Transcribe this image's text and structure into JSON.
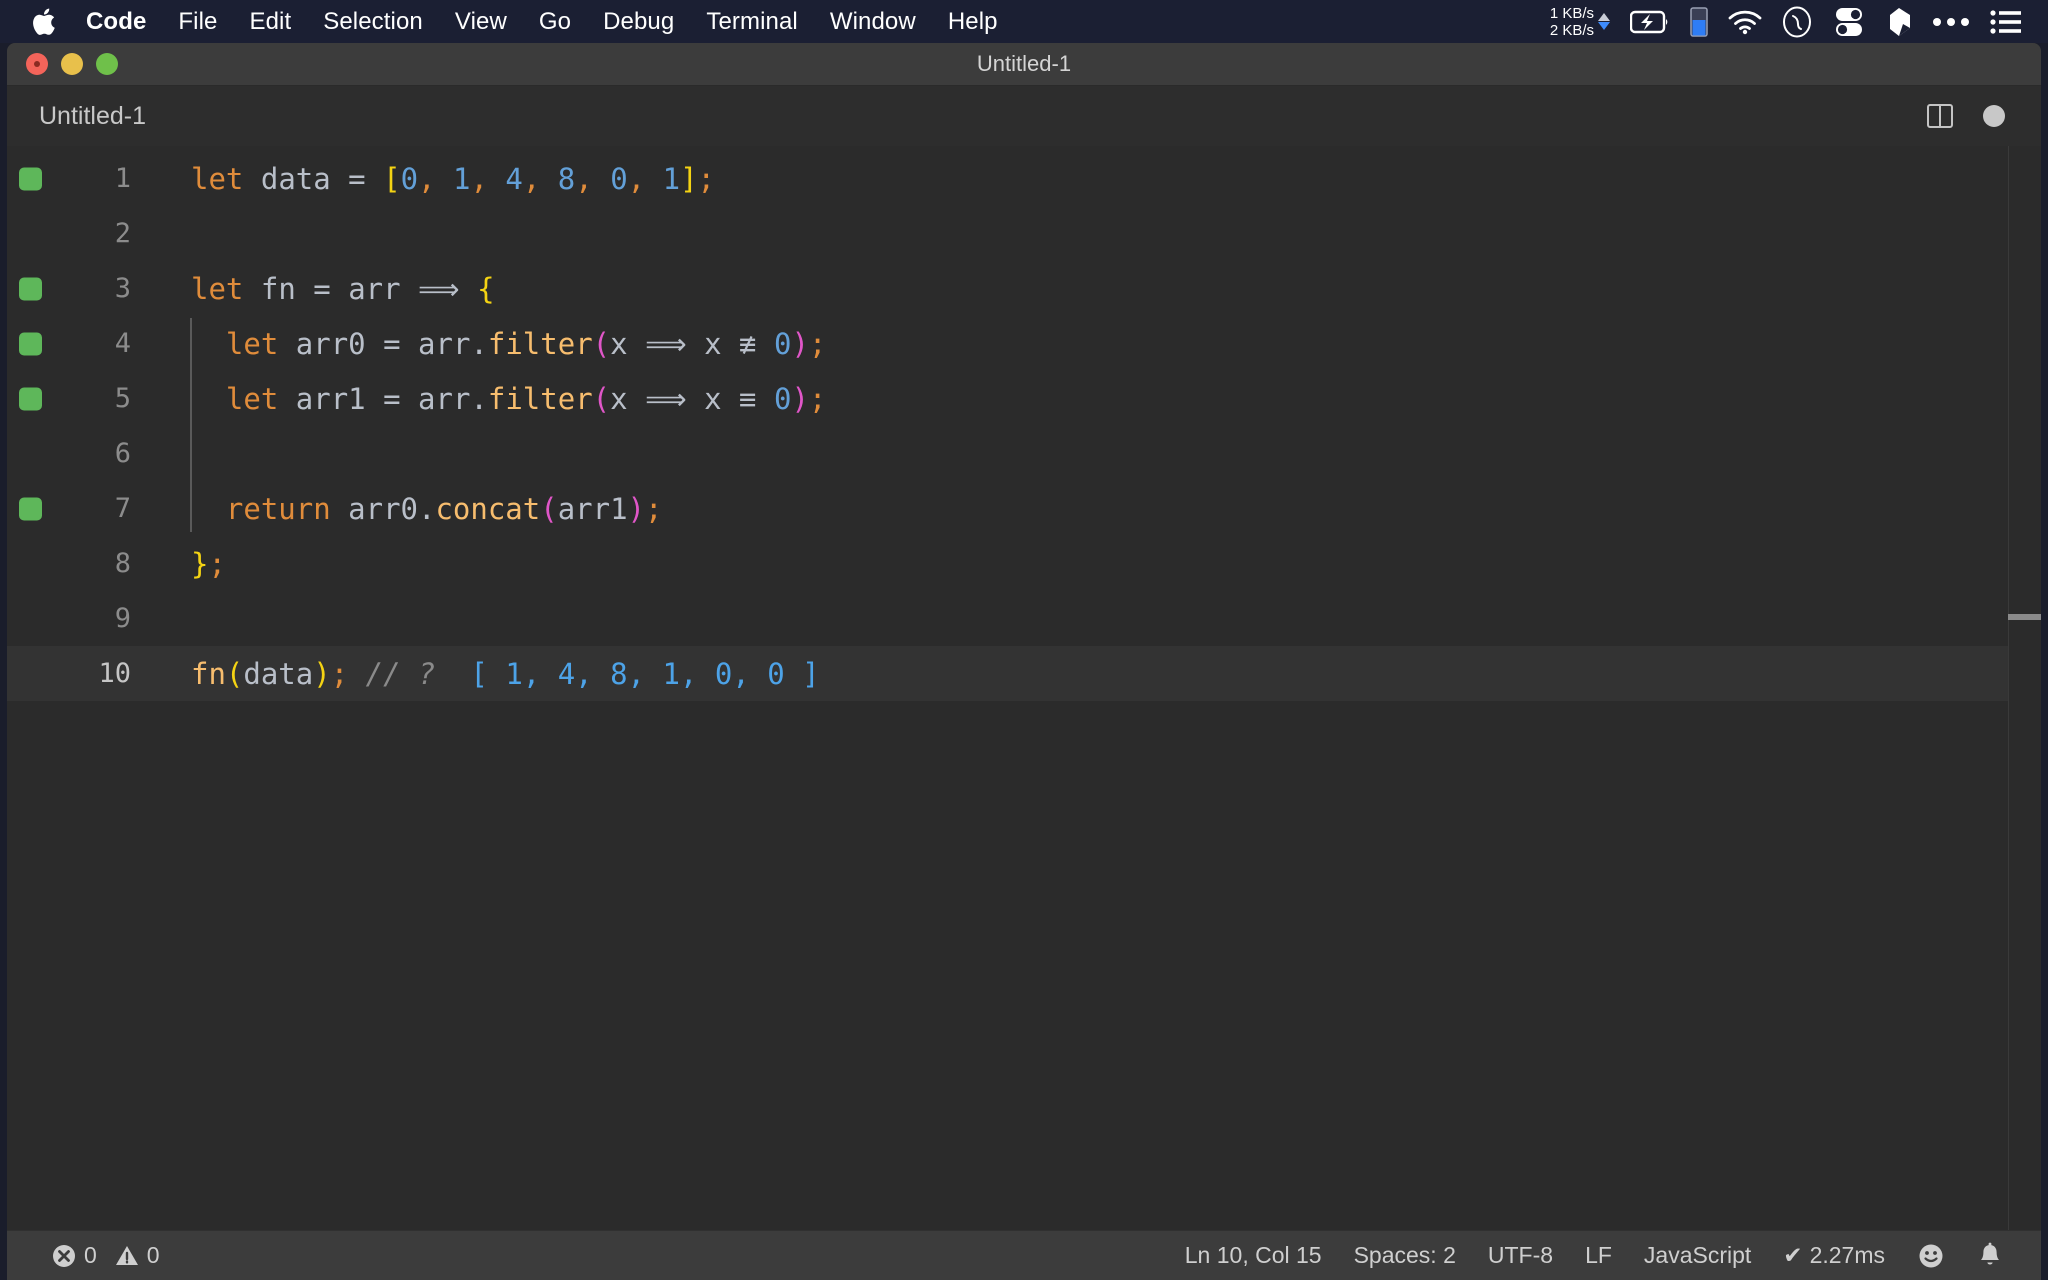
{
  "menubar": {
    "apple_icon": "apple-logo-icon",
    "items": [
      {
        "label": "Code",
        "bold": true
      },
      {
        "label": "File",
        "bold": false
      },
      {
        "label": "Edit",
        "bold": false
      },
      {
        "label": "Selection",
        "bold": false
      },
      {
        "label": "View",
        "bold": false
      },
      {
        "label": "Go",
        "bold": false
      },
      {
        "label": "Debug",
        "bold": false
      },
      {
        "label": "Terminal",
        "bold": false
      },
      {
        "label": "Window",
        "bold": false
      },
      {
        "label": "Help",
        "bold": false
      }
    ],
    "tray": {
      "upload_speed": "1 KB/s",
      "download_speed": "2 KB/s",
      "icons": [
        "battery-charging-icon",
        "battery-level-icon",
        "wifi-icon",
        "siri-icon",
        "control-center-icon",
        "dropbox-icon",
        "ellipsis-icon",
        "list-menu-icon"
      ]
    },
    "colors": {
      "background": "#1b1f33",
      "text": "#ffffff",
      "download_arrow": "#3d8bfd",
      "upload_arrow": "#c9ccd6"
    }
  },
  "window": {
    "title": "Untitled-1",
    "traffic_lights": [
      "close-button",
      "minimize-button",
      "maximize-button"
    ],
    "colors": {
      "titlebar": "#3c3c3c",
      "close": "#f4645a",
      "minimize": "#e8c04b",
      "maximize": "#6fc04a"
    }
  },
  "tabbar": {
    "tabs": [
      {
        "label": "Untitled-1",
        "active": true,
        "dirty": true
      }
    ],
    "actions": [
      "split-editor-icon",
      "unsaved-dot-icon"
    ]
  },
  "editor": {
    "language": "JavaScript",
    "colors": {
      "background": "#2b2b2b",
      "current_line": "#333333",
      "gutter_added": "#5eb75a",
      "keyword": "#e08c3b",
      "number": "#63a0d8",
      "bracket": "#f4d313",
      "paren": "#e056c8",
      "function": "#f7bd6e",
      "comment": "#8a8a8a",
      "result": "#4da3e8",
      "variable": "#b9bfc9"
    },
    "lines": [
      {
        "num": "1",
        "gutter": "added",
        "active": false,
        "indent": 0,
        "tokens": [
          {
            "t": "let",
            "c": "t-kw"
          },
          {
            "t": " ",
            "c": "t-var"
          },
          {
            "t": "data",
            "c": "t-var"
          },
          {
            "t": " ",
            "c": "t-var"
          },
          {
            "t": "=",
            "c": "t-op"
          },
          {
            "t": " ",
            "c": "t-var"
          },
          {
            "t": "[",
            "c": "t-brk"
          },
          {
            "t": "0",
            "c": "t-num"
          },
          {
            "t": ",",
            "c": "t-punc"
          },
          {
            "t": " ",
            "c": "t-var"
          },
          {
            "t": "1",
            "c": "t-num"
          },
          {
            "t": ",",
            "c": "t-punc"
          },
          {
            "t": " ",
            "c": "t-var"
          },
          {
            "t": "4",
            "c": "t-num"
          },
          {
            "t": ",",
            "c": "t-punc"
          },
          {
            "t": " ",
            "c": "t-var"
          },
          {
            "t": "8",
            "c": "t-num"
          },
          {
            "t": ",",
            "c": "t-punc"
          },
          {
            "t": " ",
            "c": "t-var"
          },
          {
            "t": "0",
            "c": "t-num"
          },
          {
            "t": ",",
            "c": "t-punc"
          },
          {
            "t": " ",
            "c": "t-var"
          },
          {
            "t": "1",
            "c": "t-num"
          },
          {
            "t": "]",
            "c": "t-brk"
          },
          {
            "t": ";",
            "c": "t-punc"
          }
        ]
      },
      {
        "num": "2",
        "gutter": "none",
        "active": false,
        "indent": 0,
        "tokens": []
      },
      {
        "num": "3",
        "gutter": "added",
        "active": false,
        "indent": 0,
        "tokens": [
          {
            "t": "let",
            "c": "t-kw"
          },
          {
            "t": " ",
            "c": "t-var"
          },
          {
            "t": "fn",
            "c": "t-var"
          },
          {
            "t": " ",
            "c": "t-var"
          },
          {
            "t": "=",
            "c": "t-op"
          },
          {
            "t": " ",
            "c": "t-var"
          },
          {
            "t": "arr",
            "c": "t-var"
          },
          {
            "t": " ",
            "c": "t-var"
          },
          {
            "t": "⟹",
            "c": "t-op"
          },
          {
            "t": " ",
            "c": "t-var"
          },
          {
            "t": "{",
            "c": "t-brk"
          }
        ]
      },
      {
        "num": "4",
        "gutter": "added",
        "active": false,
        "indent": 1,
        "tokens": [
          {
            "t": "  ",
            "c": "t-var"
          },
          {
            "t": "let",
            "c": "t-kw"
          },
          {
            "t": " ",
            "c": "t-var"
          },
          {
            "t": "arr0",
            "c": "t-var"
          },
          {
            "t": " ",
            "c": "t-var"
          },
          {
            "t": "=",
            "c": "t-op"
          },
          {
            "t": " ",
            "c": "t-var"
          },
          {
            "t": "arr",
            "c": "t-var"
          },
          {
            "t": ".",
            "c": "t-var"
          },
          {
            "t": "filter",
            "c": "t-fn"
          },
          {
            "t": "(",
            "c": "t-par"
          },
          {
            "t": "x",
            "c": "t-var"
          },
          {
            "t": " ",
            "c": "t-var"
          },
          {
            "t": "⟹",
            "c": "t-op"
          },
          {
            "t": " ",
            "c": "t-var"
          },
          {
            "t": "x",
            "c": "t-var"
          },
          {
            "t": " ",
            "c": "t-var"
          },
          {
            "t": "≢",
            "c": "t-op"
          },
          {
            "t": " ",
            "c": "t-var"
          },
          {
            "t": "0",
            "c": "t-num"
          },
          {
            "t": ")",
            "c": "t-par"
          },
          {
            "t": ";",
            "c": "t-punc"
          }
        ]
      },
      {
        "num": "5",
        "gutter": "added",
        "active": false,
        "indent": 1,
        "tokens": [
          {
            "t": "  ",
            "c": "t-var"
          },
          {
            "t": "let",
            "c": "t-kw"
          },
          {
            "t": " ",
            "c": "t-var"
          },
          {
            "t": "arr1",
            "c": "t-var"
          },
          {
            "t": " ",
            "c": "t-var"
          },
          {
            "t": "=",
            "c": "t-op"
          },
          {
            "t": " ",
            "c": "t-var"
          },
          {
            "t": "arr",
            "c": "t-var"
          },
          {
            "t": ".",
            "c": "t-var"
          },
          {
            "t": "filter",
            "c": "t-fn"
          },
          {
            "t": "(",
            "c": "t-par"
          },
          {
            "t": "x",
            "c": "t-var"
          },
          {
            "t": " ",
            "c": "t-var"
          },
          {
            "t": "⟹",
            "c": "t-op"
          },
          {
            "t": " ",
            "c": "t-var"
          },
          {
            "t": "x",
            "c": "t-var"
          },
          {
            "t": " ",
            "c": "t-var"
          },
          {
            "t": "≡",
            "c": "t-op"
          },
          {
            "t": " ",
            "c": "t-var"
          },
          {
            "t": "0",
            "c": "t-num"
          },
          {
            "t": ")",
            "c": "t-par"
          },
          {
            "t": ";",
            "c": "t-punc"
          }
        ]
      },
      {
        "num": "6",
        "gutter": "none",
        "active": false,
        "indent": 1,
        "tokens": []
      },
      {
        "num": "7",
        "gutter": "added",
        "active": false,
        "indent": 1,
        "tokens": [
          {
            "t": "  ",
            "c": "t-var"
          },
          {
            "t": "return",
            "c": "t-kw"
          },
          {
            "t": " ",
            "c": "t-var"
          },
          {
            "t": "arr0",
            "c": "t-var"
          },
          {
            "t": ".",
            "c": "t-var"
          },
          {
            "t": "concat",
            "c": "t-fn"
          },
          {
            "t": "(",
            "c": "t-par"
          },
          {
            "t": "arr1",
            "c": "t-var"
          },
          {
            "t": ")",
            "c": "t-par"
          },
          {
            "t": ";",
            "c": "t-punc"
          }
        ]
      },
      {
        "num": "8",
        "gutter": "none",
        "active": false,
        "indent": 0,
        "tokens": [
          {
            "t": "}",
            "c": "t-brk"
          },
          {
            "t": ";",
            "c": "t-punc"
          }
        ]
      },
      {
        "num": "9",
        "gutter": "none",
        "active": false,
        "indent": 0,
        "tokens": []
      },
      {
        "num": "10",
        "gutter": "added",
        "active": true,
        "indent": 0,
        "tokens": [
          {
            "t": "fn",
            "c": "t-fn"
          },
          {
            "t": "(",
            "c": "t-brk"
          },
          {
            "t": "data",
            "c": "t-var"
          },
          {
            "t": ")",
            "c": "t-brk"
          },
          {
            "t": ";",
            "c": "t-punc"
          },
          {
            "t": " ",
            "c": "t-var"
          },
          {
            "t": "// ?",
            "c": "t-cmt"
          },
          {
            "t": "  ",
            "c": "t-var"
          },
          {
            "t": "[ 1, 4, 8, 1, 0, 0 ]",
            "c": "t-res"
          }
        ]
      }
    ]
  },
  "statusbar": {
    "error_count": "0",
    "warning_count": "0",
    "cursor": "Ln 10, Col 15",
    "indentation": "Spaces: 2",
    "encoding": "UTF-8",
    "eol": "LF",
    "language": "JavaScript",
    "runtime": "2.27ms",
    "runtime_check": "✔",
    "icons": [
      "error-icon",
      "warning-icon",
      "feedback-smiley-icon",
      "notifications-bell-icon"
    ],
    "colors": {
      "background": "#3c3c3c",
      "text": "#cfcfcf"
    }
  }
}
